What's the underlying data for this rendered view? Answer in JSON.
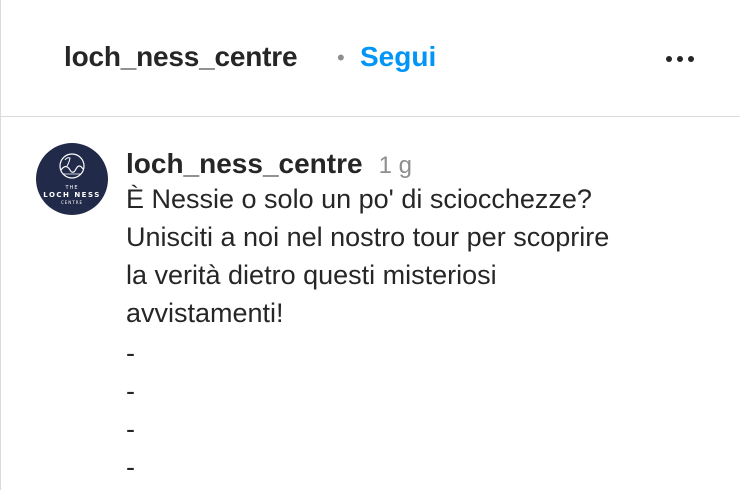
{
  "header": {
    "username": "loch_ness_centre",
    "separator": "•",
    "follow_label": "Segui",
    "more_icon": "more-horizontal-icon"
  },
  "avatar": {
    "line1": "THE",
    "line2": "LOCH NESS",
    "line3": "CENTRE",
    "colors": {
      "background": "#222a4a",
      "foreground": "#ffffff"
    }
  },
  "comment": {
    "username": "loch_ness_centre",
    "time": "1 g",
    "body": "È Nessie o solo un po' di sciocchezze?\nUnisciti a noi nel nostro tour per scoprire\nla verità dietro questi misteriosi\navvistamenti!",
    "dashes": [
      "-",
      "-",
      "-",
      "-"
    ]
  },
  "colors": {
    "accent": "#0095f6",
    "text": "#262626",
    "muted": "#8e8e8e",
    "border": "#dbdbdb"
  }
}
